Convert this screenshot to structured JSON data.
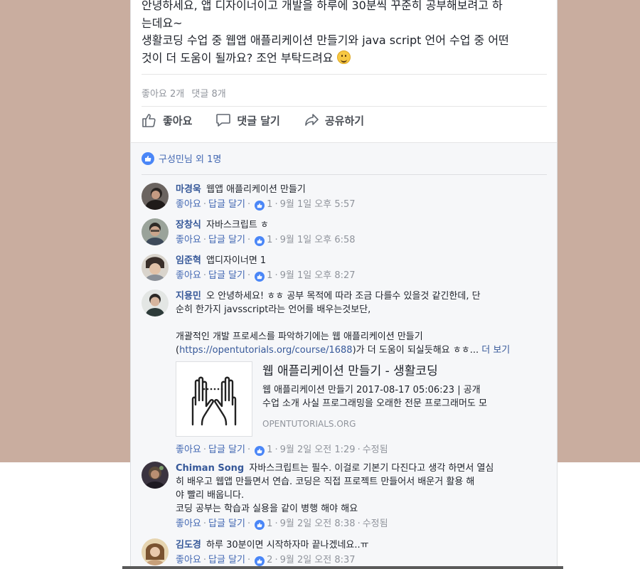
{
  "post": {
    "line1": "안녕하세요, 앱 디자이너이고 개발을 하루에 30분씩 꾸준히 공부해보려고 하",
    "line2": "는데요~",
    "line3": "생활코딩 수업 중 웹앱 애플리케이션 만들기와 java script 언어 수업 중 어떤",
    "line4": "것이 더 도움이 될까요? 조언 부탁드려요",
    "likes": "좋아요 2개",
    "comment_count": "댓글 8개",
    "emoji": "smile-emoji"
  },
  "actions": {
    "like": "좋아요",
    "comment": "댓글 달기",
    "share": "공유하기"
  },
  "liked_by": "구성민님 외 1명",
  "comment_meta": {
    "like": "좋아요",
    "reply": "답글 달기",
    "dot": "·"
  },
  "comments": [
    {
      "author": "마경욱",
      "text": "웹앱 애플리케이션 만들기",
      "likes": "1",
      "time": "9월 1일 오후 5:57"
    },
    {
      "author": "장창식",
      "text": "자바스크립트 ㅎ",
      "likes": "1",
      "time": "9월 1일 오후 6:58"
    },
    {
      "author": "임준혁",
      "text": "앱디자이너면 1",
      "likes": "1",
      "time": "9월 1일 오후 8:27"
    },
    {
      "author": "지용민",
      "text1": "오 안녕하세요! ㅎㅎ 공부 목적에 따라 조금 다를수 있을것 같긴한데, 단",
      "text2": "순히 한가지 javsscript라는 언어를 배우는것보단,",
      "text3": "개괄적인 개발 프로세스를 파악하기에는 웹 애플리케이션 만들기",
      "link": "https://opentutorials.org/course/1688",
      "text4": ")가 더 도움이 되실듯해요 ㅎㅎ...",
      "see_more": "더 보기",
      "preview_title": "웹 애플리케이션 만들기 - 생활코딩",
      "preview_desc": "웹 애플리케이션 만들기 2017-08-17 05:06:23 | 공개 수업 소개 사실 프로그래밍을 오래한 전문 프로그래머도 모든...",
      "preview_domain": "OPENTUTORIALS.ORG",
      "likes": "1",
      "time": "9월 2일 오전 1:29",
      "edited": "수정됨"
    },
    {
      "author": "Chiman Song",
      "text1": "자바스크립트는 필수. 이걸로 기본기 다진다고 생각 하면서 열심",
      "text2": "히 배우고 웹앱 만들면서 연습. 코딩은 직접 프로젝트 만들어서 배운거 활용 해",
      "text3": "야 빨리 배웁니다.",
      "text4": "코딩 공부는 학습과 실용을 같이 병행 해야 해요",
      "likes": "1",
      "time": "9월 2일 오전 8:38",
      "edited": "수정됨"
    },
    {
      "author": "김도경",
      "text": "하루 30분이면 시작하자마 끝나겠네요..ㅠ",
      "likes": "2",
      "time": "9월 2일 오전 8:37"
    }
  ],
  "colors": {
    "background": "#c9ad9f",
    "link": "#365899",
    "like_blue": "#4a86f7"
  }
}
